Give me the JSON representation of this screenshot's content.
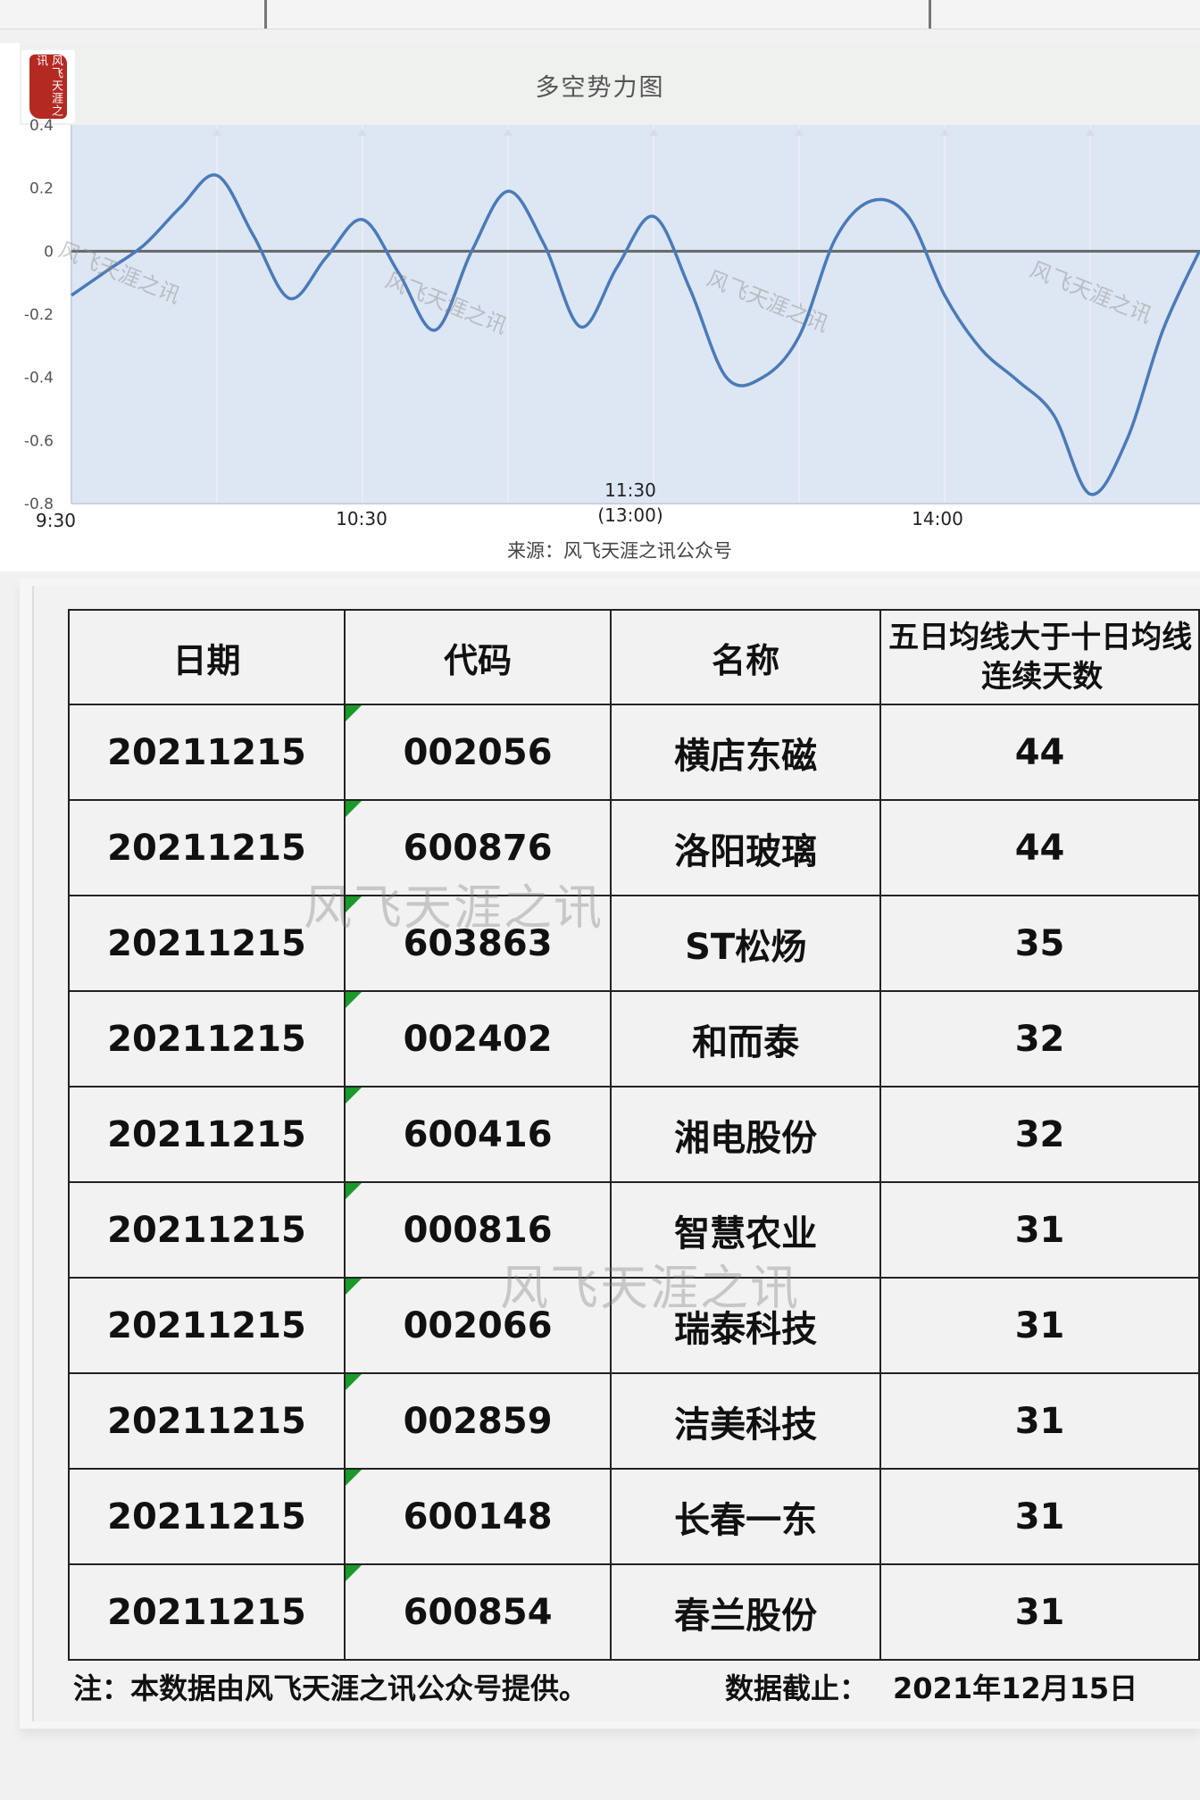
{
  "chart_data": {
    "type": "line",
    "title": "多空势力图",
    "source": "来源：风飞天涯之讯公众号",
    "ylim": [
      -0.8,
      0.4
    ],
    "y_ticks": [
      "0.4",
      "0.2",
      "0",
      "-0.2",
      "-0.4",
      "-0.6",
      "-0.8"
    ],
    "x_ticks": [
      {
        "label": "9:30"
      },
      {
        "label": "10:30"
      },
      {
        "label": "11:30",
        "sub": "(13:00)"
      },
      {
        "label": "14:00"
      }
    ],
    "grid": true,
    "series": [
      {
        "color": "#4a7ab8",
        "x": [
          0,
          0.25,
          0.5,
          0.75,
          1,
          1.25,
          1.5,
          1.75,
          2,
          2.25,
          2.5,
          2.75,
          3,
          3.25,
          3.5,
          3.75,
          4,
          4.25,
          4.5,
          4.75,
          5,
          5.25,
          5.5,
          5.75,
          6,
          6.25,
          6.5,
          6.75,
          7,
          7.25,
          7.5,
          7.75
        ],
        "values": [
          -0.14,
          -0.06,
          0.02,
          0.14,
          0.24,
          0.05,
          -0.15,
          -0.02,
          0.1,
          -0.07,
          -0.25,
          0.0,
          0.19,
          0.02,
          -0.24,
          -0.05,
          0.11,
          -0.12,
          -0.4,
          -0.4,
          -0.27,
          0.04,
          0.16,
          0.11,
          -0.14,
          -0.31,
          -0.41,
          -0.52,
          -0.77,
          -0.6,
          -0.25,
          0.0
        ]
      }
    ]
  },
  "watermark_text": "风飞天涯之讯",
  "logo_text": "风飞天涯之讯",
  "table": {
    "headers": [
      "日期",
      "代码",
      "名称",
      "五日均线大于十日均线",
      "连续天数"
    ],
    "rows": [
      {
        "date": "20211215",
        "code": "002056",
        "name": "横店东磁",
        "days": "44"
      },
      {
        "date": "20211215",
        "code": "600876",
        "name": "洛阳玻璃",
        "days": "44"
      },
      {
        "date": "20211215",
        "code": "603863",
        "name": "ST松炀",
        "days": "35"
      },
      {
        "date": "20211215",
        "code": "002402",
        "name": "和而泰",
        "days": "32"
      },
      {
        "date": "20211215",
        "code": "600416",
        "name": "湘电股份",
        "days": "32"
      },
      {
        "date": "20211215",
        "code": "000816",
        "name": "智慧农业",
        "days": "31"
      },
      {
        "date": "20211215",
        "code": "002066",
        "name": "瑞泰科技",
        "days": "31"
      },
      {
        "date": "20211215",
        "code": "002859",
        "name": "洁美科技",
        "days": "31"
      },
      {
        "date": "20211215",
        "code": "600148",
        "name": "长春一东",
        "days": "31"
      },
      {
        "date": "20211215",
        "code": "600854",
        "name": "春兰股份",
        "days": "31"
      }
    ]
  },
  "footer": {
    "note": "注：本数据由风飞天涯之讯公众号提供。",
    "cutoff_label": "数据截止：",
    "cutoff_date": "2021年12月15日"
  },
  "colors": {
    "plot_bg": "#dde6f3",
    "line": "#4a7ab8",
    "zero_line": "#666666",
    "flag": "#1a9a2a"
  }
}
